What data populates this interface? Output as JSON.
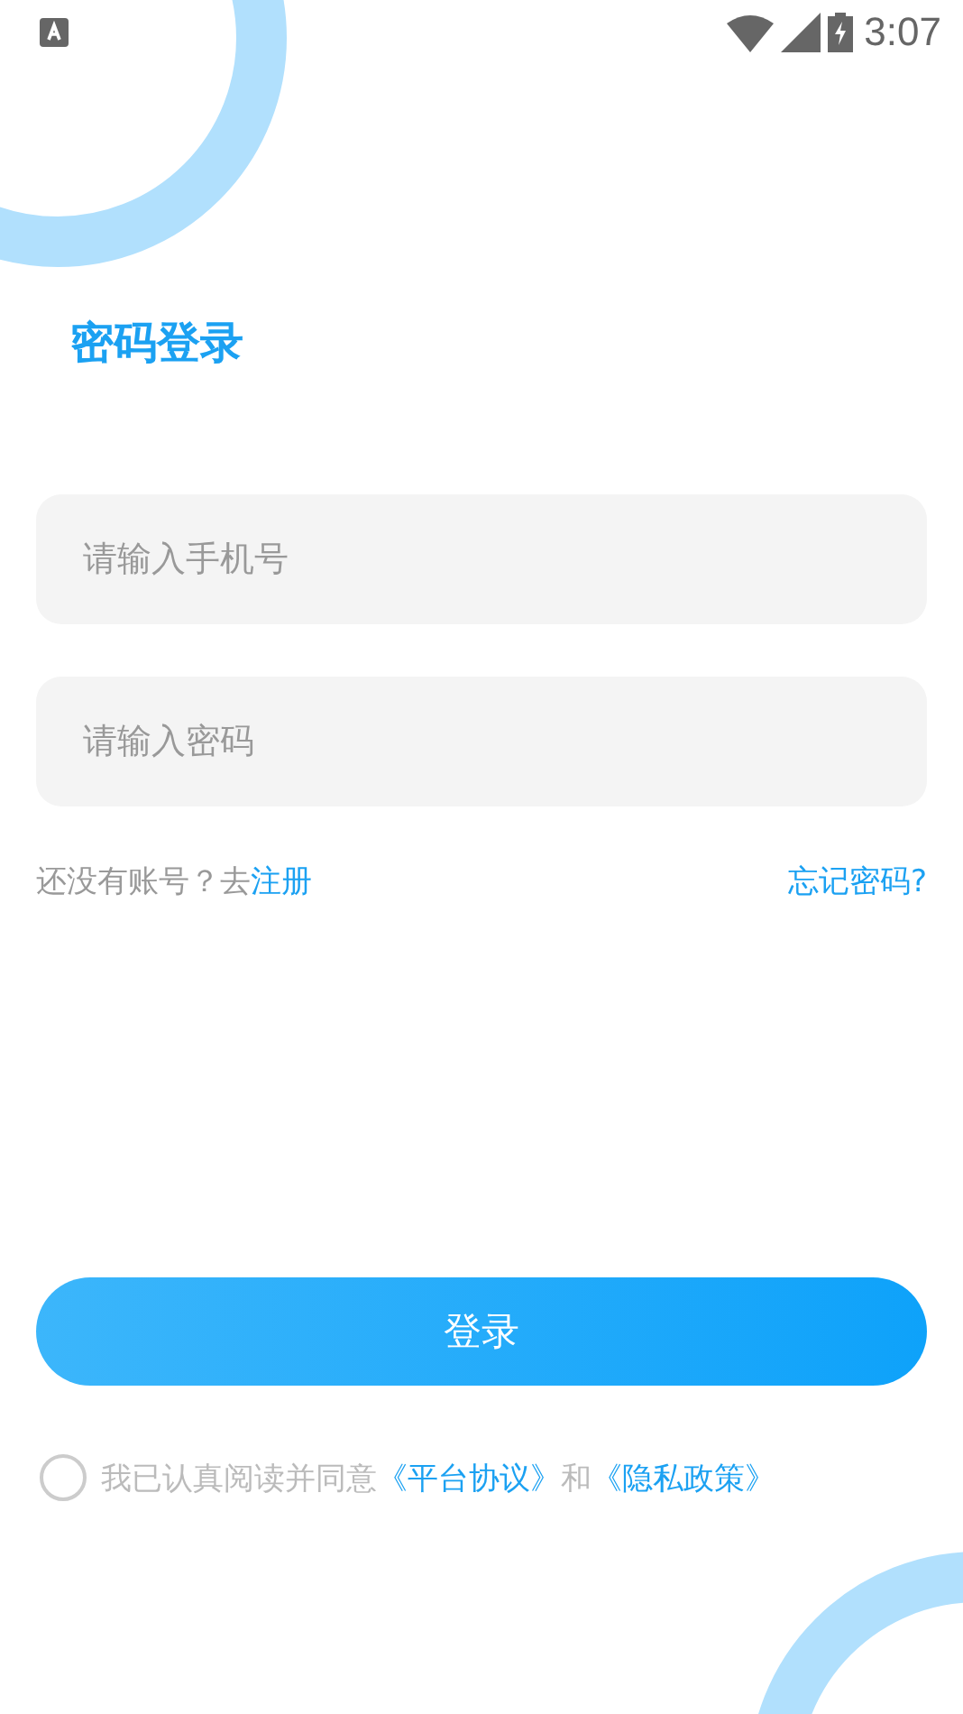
{
  "status_bar": {
    "time": "3:07"
  },
  "title": "密码登录",
  "fields": [
    {
      "placeholder": "请输入手机号"
    },
    {
      "placeholder": "请输入密码"
    }
  ],
  "register_prompt": {
    "text": "还没有账号？去",
    "link": "注册"
  },
  "forgot_link": "忘记密码?",
  "login_button": "登录",
  "agreement": {
    "checked": false,
    "text": "我已认真阅读并同意",
    "link_1": "《平台协议》",
    "joiner": "和",
    "link_2": "《隐私政策》"
  }
}
